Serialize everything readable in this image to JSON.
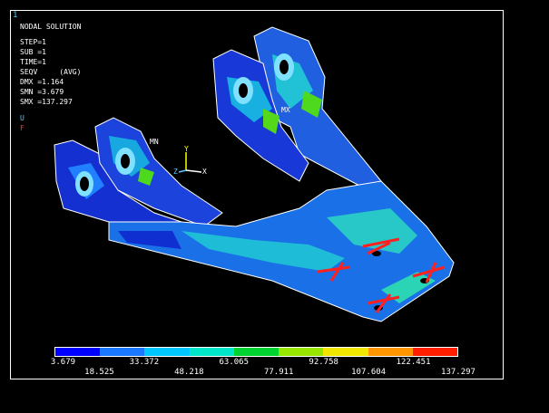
{
  "window_number": "1",
  "info_lines": [
    "NODAL SOLUTION",
    "STEP=1",
    "SUB =1",
    "TIME=1",
    "SEQV     (AVG)",
    "DMX =1.164",
    "SMN =3.679",
    "SMX =137.297"
  ],
  "legend_symbols": {
    "u": "U",
    "f": "F"
  },
  "markers": {
    "min": "MN",
    "max": "MX"
  },
  "triad": {
    "x": "X",
    "y": "Y",
    "z": "Z"
  },
  "colorbar": {
    "colors": [
      "#0000ff",
      "#1a78ff",
      "#00c8ff",
      "#00e6c8",
      "#00d232",
      "#96e600",
      "#f0e600",
      "#ff9600",
      "#ff1e00"
    ],
    "values_top": [
      "3.679",
      "33.372",
      "63.065",
      "92.758",
      "122.451"
    ],
    "values_bottom": [
      "18.525",
      "48.218",
      "77.911",
      "107.604",
      "137.297"
    ]
  }
}
